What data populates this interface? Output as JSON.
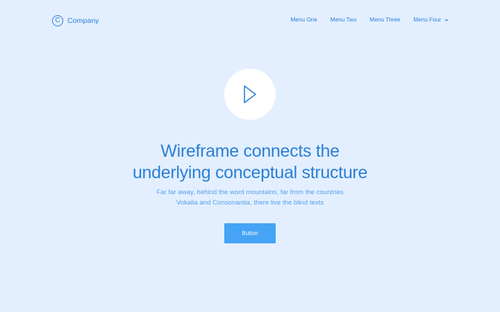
{
  "brand": {
    "logo_glyph": "C",
    "name": "Company"
  },
  "nav": {
    "items": [
      {
        "label": "Menu One"
      },
      {
        "label": "Menu Two"
      },
      {
        "label": "Menu Three"
      },
      {
        "label": "Menu Four",
        "icon": "chevron-down-icon"
      }
    ]
  },
  "hero": {
    "play_icon": "play-icon",
    "title_line1": "Wireframe connects the",
    "title_line2": "underlying conceptual structure",
    "subtitle_line1": "Far far away, behind the word mountains, far from the countries",
    "subtitle_line2": "Vokalia and Consonantia, there live the blind texts",
    "button_label": "Button"
  },
  "colors": {
    "background": "#e3efff",
    "text_primary": "#2a7fd4",
    "text_secondary": "#55a0ea",
    "button": "#45a4f5",
    "play_circle": "#ffffff"
  }
}
